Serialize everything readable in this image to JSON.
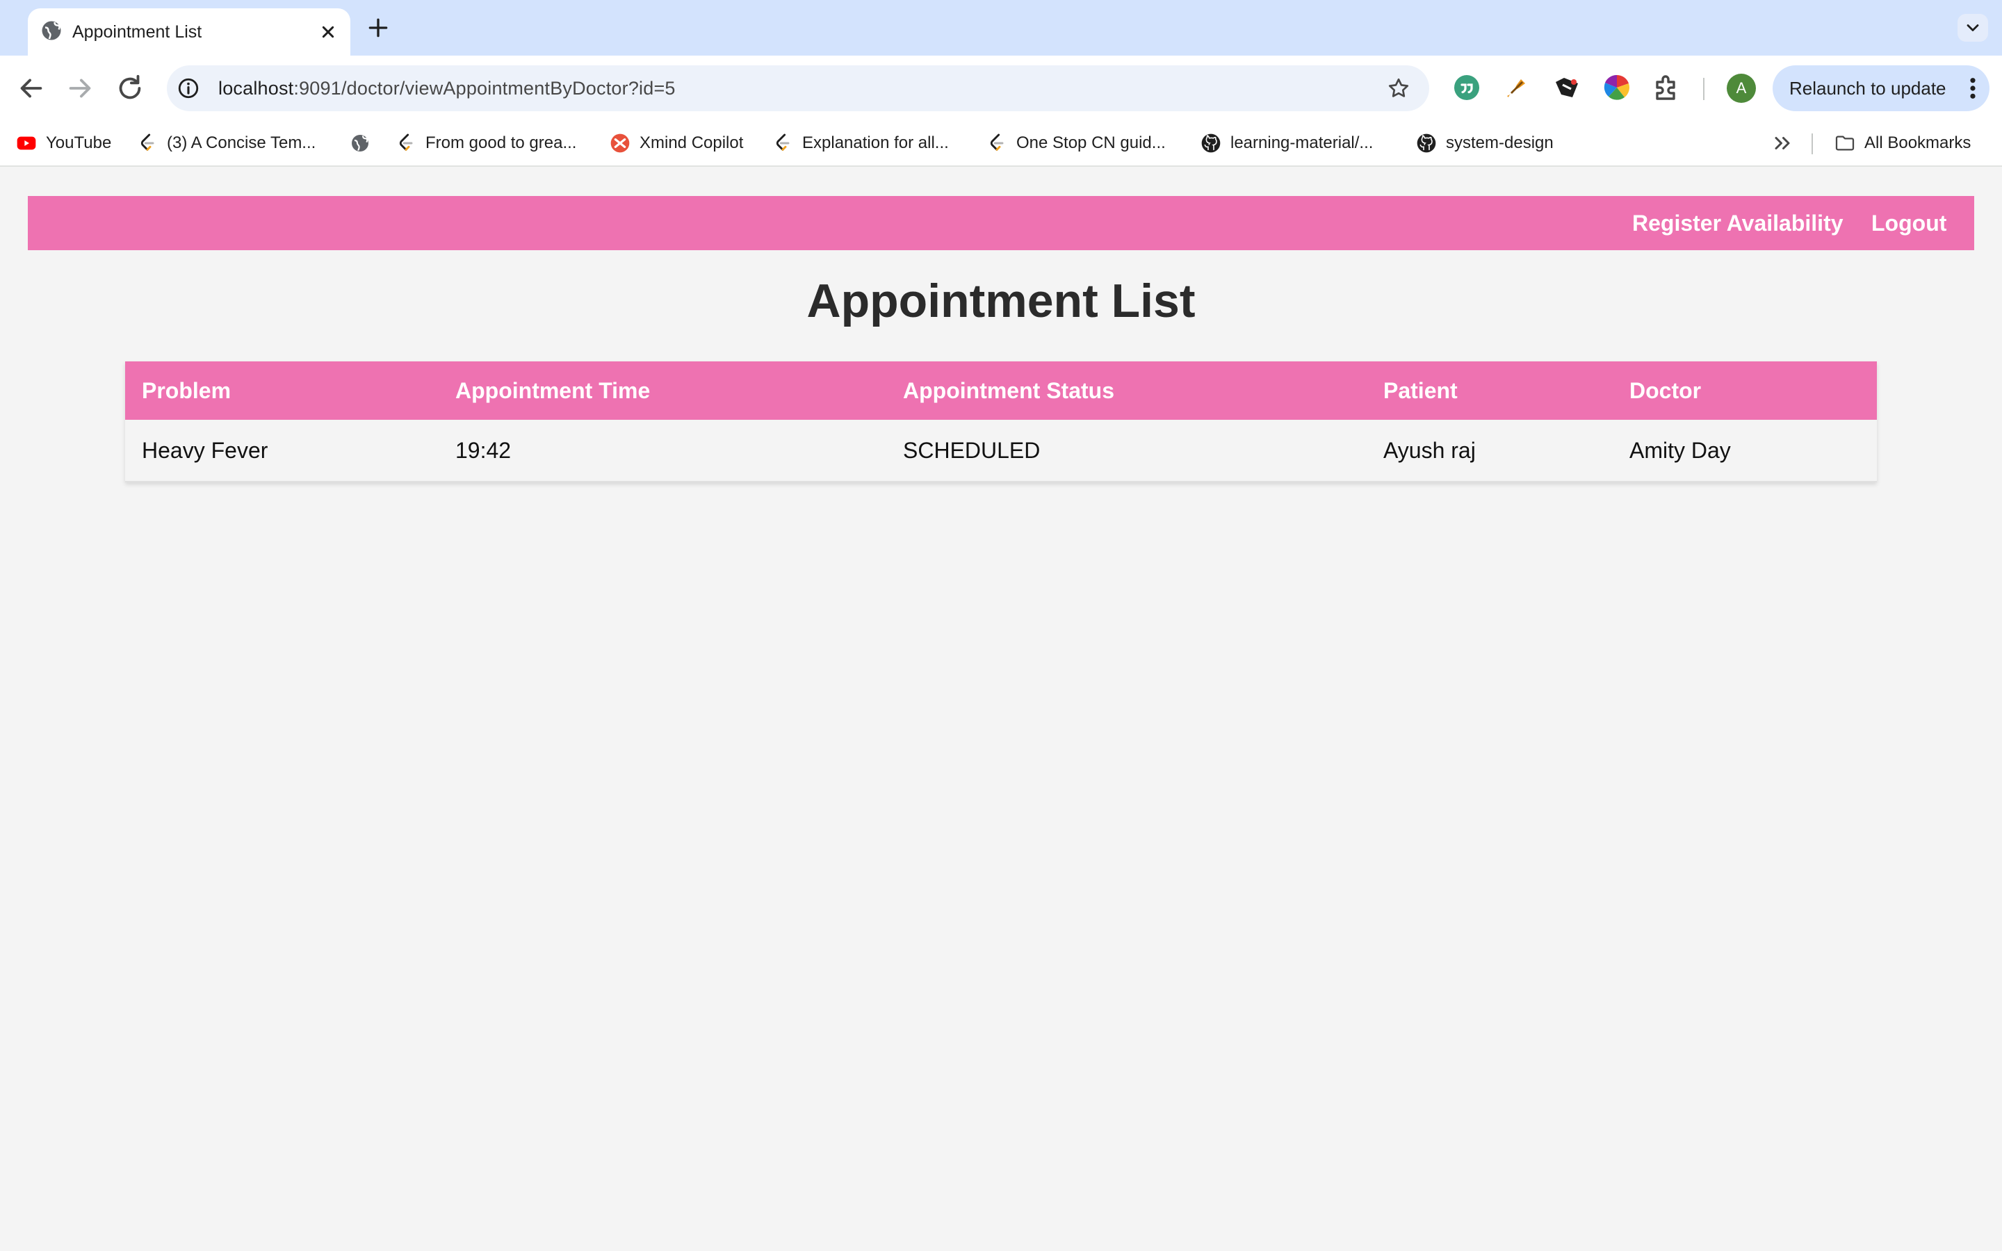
{
  "browser": {
    "tab": {
      "title": "Appointment List"
    },
    "omnibox": {
      "host": "localhost",
      "path": ":9091/doctor/viewAppointmentByDoctor?id=5"
    },
    "profile_initial": "A",
    "relaunch_label": "Relaunch to update",
    "bookmarks": [
      {
        "label": "YouTube",
        "icon": "youtube-icon"
      },
      {
        "label": "(3) A Concise Tem...",
        "icon": "leetcode-icon"
      },
      {
        "label": "",
        "icon": "globe-icon"
      },
      {
        "label": "From good to grea...",
        "icon": "leetcode-icon"
      },
      {
        "label": "Xmind Copilot",
        "icon": "xmind-icon"
      },
      {
        "label": "Explanation for all...",
        "icon": "leetcode-icon"
      },
      {
        "label": "One Stop CN guid...",
        "icon": "leetcode-icon"
      },
      {
        "label": "learning-material/...",
        "icon": "github-icon"
      },
      {
        "label": "system-design",
        "icon": "github-icon"
      }
    ],
    "all_bookmarks_label": "All Bookmarks"
  },
  "nav": {
    "register_label": "Register Availability",
    "logout_label": "Logout"
  },
  "page": {
    "title": "Appointment List"
  },
  "table": {
    "headers": [
      "Problem",
      "Appointment Time",
      "Appointment Status",
      "Patient",
      "Doctor"
    ],
    "rows": [
      [
        "Heavy Fever",
        "19:42",
        "SCHEDULED",
        "Ayush raj",
        "Amity Day"
      ]
    ]
  },
  "colors": {
    "accent": "#ee72b1",
    "page_bg": "#f4f4f4",
    "chrome_tab_strip": "#d3e3fd"
  }
}
